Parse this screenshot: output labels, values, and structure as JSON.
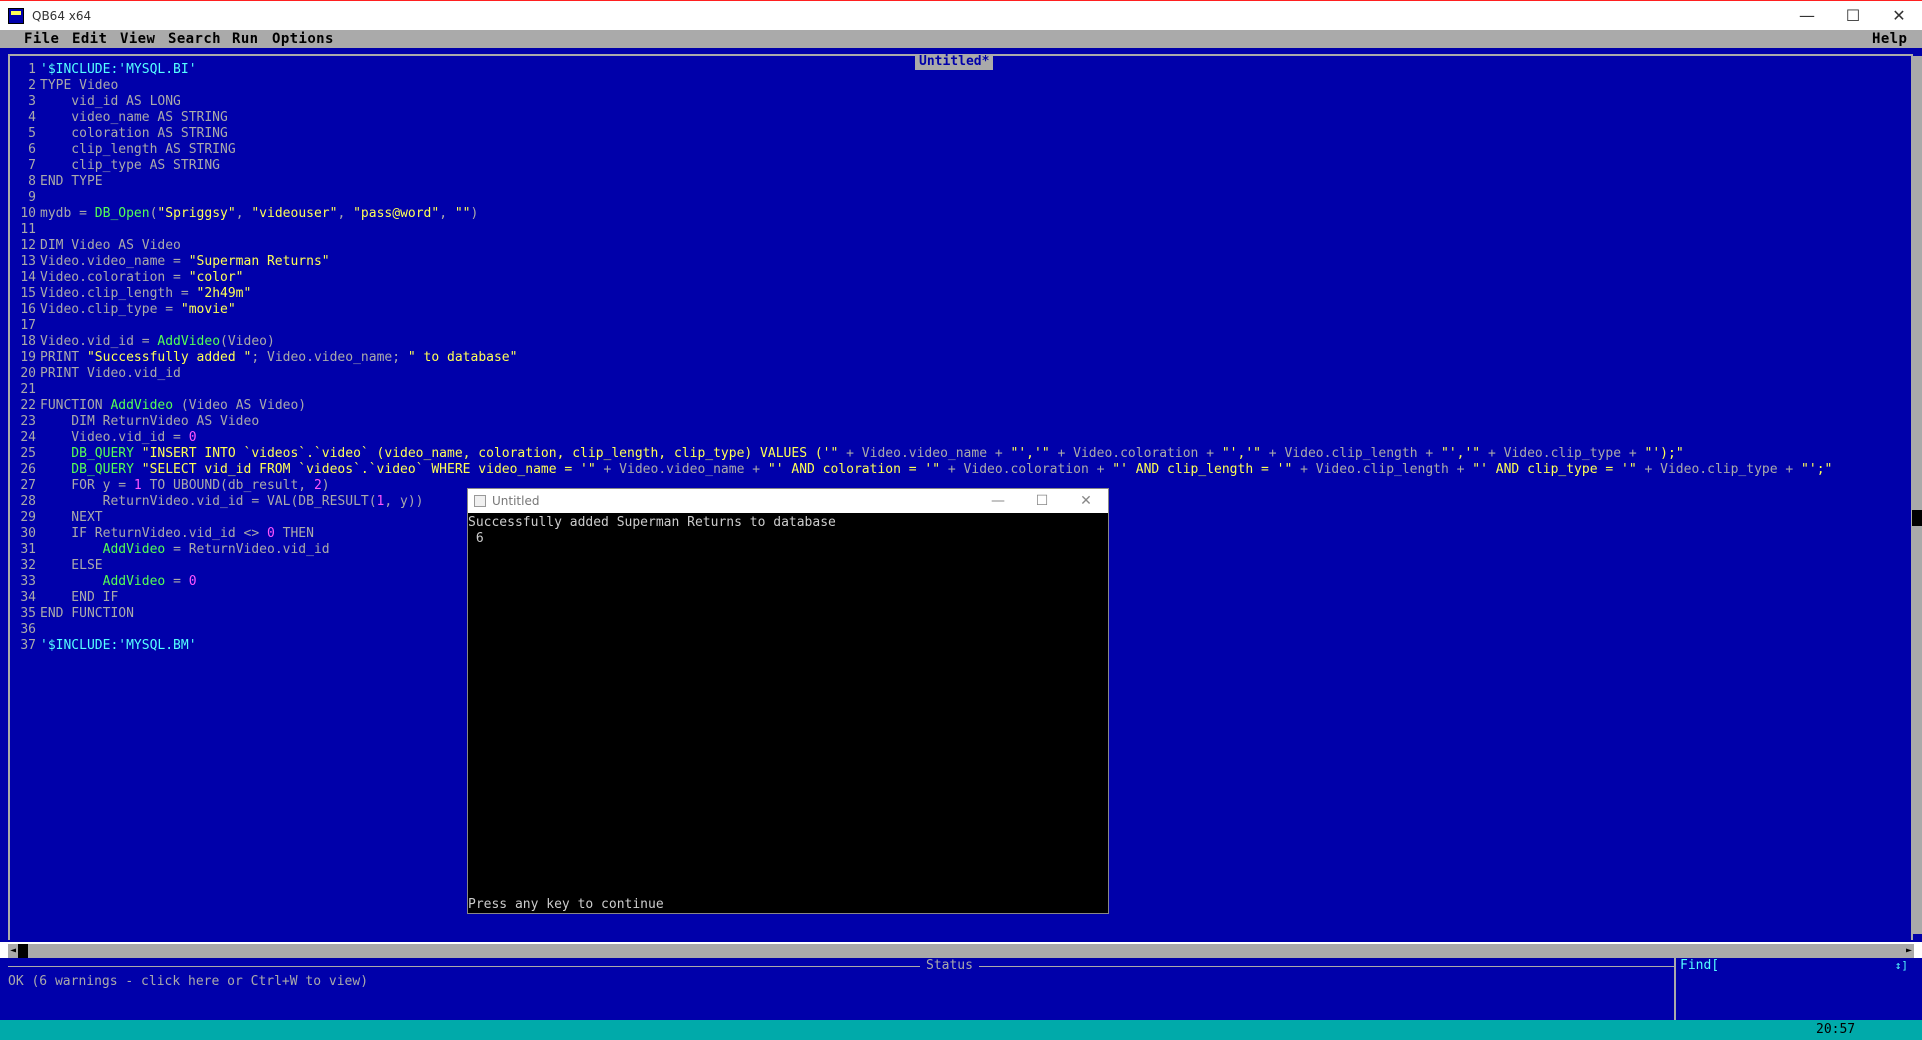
{
  "window": {
    "title": "QB64 x64",
    "minimize": "—",
    "maximize": "☐",
    "close": "✕"
  },
  "menu": {
    "file": "File",
    "edit": "Edit",
    "view": "View",
    "search": "Search",
    "run": "Run",
    "options": "Options",
    "help": "Help"
  },
  "editor": {
    "title": "Untitled*",
    "line_numbers": [
      "1",
      "2",
      "3",
      "4",
      "5",
      "6",
      "7",
      "8",
      "9",
      "10",
      "11",
      "12",
      "13",
      "14",
      "15",
      "16",
      "17",
      "18",
      "19",
      "20",
      "21",
      "22",
      "23",
      "24",
      "25",
      "26",
      "27",
      "28",
      "29",
      "30",
      "31",
      "32",
      "33",
      "34",
      "35",
      "36",
      "37"
    ],
    "lines": [
      [
        {
          "t": "'$INCLUDE:'MYSQL.BI'",
          "c": "mt"
        }
      ],
      [
        {
          "t": "TYPE Video",
          "c": "kw"
        }
      ],
      [
        {
          "t": "    vid_id AS LONG",
          "c": "kw"
        }
      ],
      [
        {
          "t": "    video_name AS STRING",
          "c": "kw"
        }
      ],
      [
        {
          "t": "    coloration AS STRING",
          "c": "kw"
        }
      ],
      [
        {
          "t": "    clip_length AS STRING",
          "c": "kw"
        }
      ],
      [
        {
          "t": "    clip_type AS STRING",
          "c": "kw"
        }
      ],
      [
        {
          "t": "END TYPE",
          "c": "kw"
        }
      ],
      [
        {
          "t": "",
          "c": "kw"
        }
      ],
      [
        {
          "t": "mydb = ",
          "c": "kw"
        },
        {
          "t": "DB_Open",
          "c": "fn"
        },
        {
          "t": "(",
          "c": "kw"
        },
        {
          "t": "\"Spriggsy\"",
          "c": "st"
        },
        {
          "t": ", ",
          "c": "kw"
        },
        {
          "t": "\"videouser\"",
          "c": "st"
        },
        {
          "t": ", ",
          "c": "kw"
        },
        {
          "t": "\"pass@word\"",
          "c": "st"
        },
        {
          "t": ", ",
          "c": "kw"
        },
        {
          "t": "\"\"",
          "c": "st"
        },
        {
          "t": ")",
          "c": "kw"
        }
      ],
      [
        {
          "t": "",
          "c": "kw"
        }
      ],
      [
        {
          "t": "DIM Video AS Video",
          "c": "kw"
        }
      ],
      [
        {
          "t": "Video.video_name = ",
          "c": "kw"
        },
        {
          "t": "\"Superman Returns\"",
          "c": "st"
        }
      ],
      [
        {
          "t": "Video.coloration = ",
          "c": "kw"
        },
        {
          "t": "\"color\"",
          "c": "st"
        }
      ],
      [
        {
          "t": "Video.clip_length = ",
          "c": "kw"
        },
        {
          "t": "\"2h49m\"",
          "c": "st"
        }
      ],
      [
        {
          "t": "Video.clip_type = ",
          "c": "kw"
        },
        {
          "t": "\"movie\"",
          "c": "st"
        }
      ],
      [
        {
          "t": "",
          "c": "kw"
        }
      ],
      [
        {
          "t": "Video.vid_id = ",
          "c": "kw"
        },
        {
          "t": "AddVideo",
          "c": "fn"
        },
        {
          "t": "(Video)",
          "c": "kw"
        }
      ],
      [
        {
          "t": "PRINT ",
          "c": "kw"
        },
        {
          "t": "\"Successfully added \"",
          "c": "st"
        },
        {
          "t": "; Video.video_name; ",
          "c": "kw"
        },
        {
          "t": "\" to database\"",
          "c": "st"
        }
      ],
      [
        {
          "t": "PRINT Video.vid_id",
          "c": "kw"
        }
      ],
      [
        {
          "t": "",
          "c": "kw"
        }
      ],
      [
        {
          "t": "FUNCTION ",
          "c": "kw"
        },
        {
          "t": "AddVideo",
          "c": "fn"
        },
        {
          "t": " (Video AS Video)",
          "c": "kw"
        }
      ],
      [
        {
          "t": "    DIM ReturnVideo AS Video",
          "c": "kw"
        }
      ],
      [
        {
          "t": "    Video.vid_id = ",
          "c": "kw"
        },
        {
          "t": "0",
          "c": "nu"
        }
      ],
      [
        {
          "t": "    DB_QUERY ",
          "c": "fn"
        },
        {
          "t": "\"INSERT INTO `videos`.`video` (video_name, coloration, clip_length, clip_type) VALUES ('\"",
          "c": "st"
        },
        {
          "t": " + Video.video_name + ",
          "c": "kw"
        },
        {
          "t": "\"','\"",
          "c": "st"
        },
        {
          "t": " + Video.coloration + ",
          "c": "kw"
        },
        {
          "t": "\"','\"",
          "c": "st"
        },
        {
          "t": " + Video.clip_length + ",
          "c": "kw"
        },
        {
          "t": "\"','\"",
          "c": "st"
        },
        {
          "t": " + Video.clip_type + ",
          "c": "kw"
        },
        {
          "t": "\"');\"",
          "c": "st"
        }
      ],
      [
        {
          "t": "    DB_QUERY ",
          "c": "fn"
        },
        {
          "t": "\"SELECT vid_id FROM `videos`.`video` WHERE video_name = '\"",
          "c": "st"
        },
        {
          "t": " + Video.video_name + ",
          "c": "kw"
        },
        {
          "t": "\"' AND coloration = '\"",
          "c": "st"
        },
        {
          "t": " + Video.coloration + ",
          "c": "kw"
        },
        {
          "t": "\"' AND clip_length = '\"",
          "c": "st"
        },
        {
          "t": " + Video.clip_length + ",
          "c": "kw"
        },
        {
          "t": "\"' AND clip_type = '\"",
          "c": "st"
        },
        {
          "t": " + Video.clip_type + ",
          "c": "kw"
        },
        {
          "t": "\"';\"",
          "c": "st"
        }
      ],
      [
        {
          "t": "    FOR y = ",
          "c": "kw"
        },
        {
          "t": "1",
          "c": "nu"
        },
        {
          "t": " TO UBOUND(db_result, ",
          "c": "kw"
        },
        {
          "t": "2",
          "c": "nu"
        },
        {
          "t": ")",
          "c": "kw"
        }
      ],
      [
        {
          "t": "        ReturnVideo.vid_id = VAL(DB_RESULT(",
          "c": "kw"
        },
        {
          "t": "1",
          "c": "nu"
        },
        {
          "t": ", y))",
          "c": "kw"
        }
      ],
      [
        {
          "t": "    NEXT",
          "c": "kw"
        }
      ],
      [
        {
          "t": "    IF ReturnVideo.vid_id <> ",
          "c": "kw"
        },
        {
          "t": "0",
          "c": "nu"
        },
        {
          "t": " THEN",
          "c": "kw"
        }
      ],
      [
        {
          "t": "        ",
          "c": "kw"
        },
        {
          "t": "AddVideo",
          "c": "fn"
        },
        {
          "t": " = ReturnVideo.vid_id",
          "c": "kw"
        }
      ],
      [
        {
          "t": "    ELSE",
          "c": "kw"
        }
      ],
      [
        {
          "t": "        ",
          "c": "kw"
        },
        {
          "t": "AddVideo",
          "c": "fn"
        },
        {
          "t": " = ",
          "c": "kw"
        },
        {
          "t": "0",
          "c": "nu"
        }
      ],
      [
        {
          "t": "    END IF",
          "c": "kw"
        }
      ],
      [
        {
          "t": "END FUNCTION",
          "c": "kw"
        }
      ],
      [
        {
          "t": "",
          "c": "kw"
        }
      ],
      [
        {
          "t": "'$INCLUDE:'MYSQL.BM'",
          "c": "mt"
        }
      ]
    ]
  },
  "status": {
    "title": "Status",
    "message": "OK (6 warnings - click here or Ctrl+W to view)",
    "find_label": "Find[",
    "find_arrows": "↕]",
    "clock": "20:57"
  },
  "console": {
    "title": "Untitled",
    "minimize": "—",
    "maximize": "☐",
    "close": "✕",
    "output_line1": "Successfully added Superman Returns to database",
    "output_line2": " 6",
    "prompt": "Press any key to continue"
  },
  "colors": {
    "editor_bg": "#0000aa",
    "menu_bg": "#aaaaaa",
    "string": "#ffff55",
    "function": "#55ff55",
    "number": "#ff55ff",
    "metacommand": "#55ffff",
    "bottom_bar": "#00aaaa"
  }
}
